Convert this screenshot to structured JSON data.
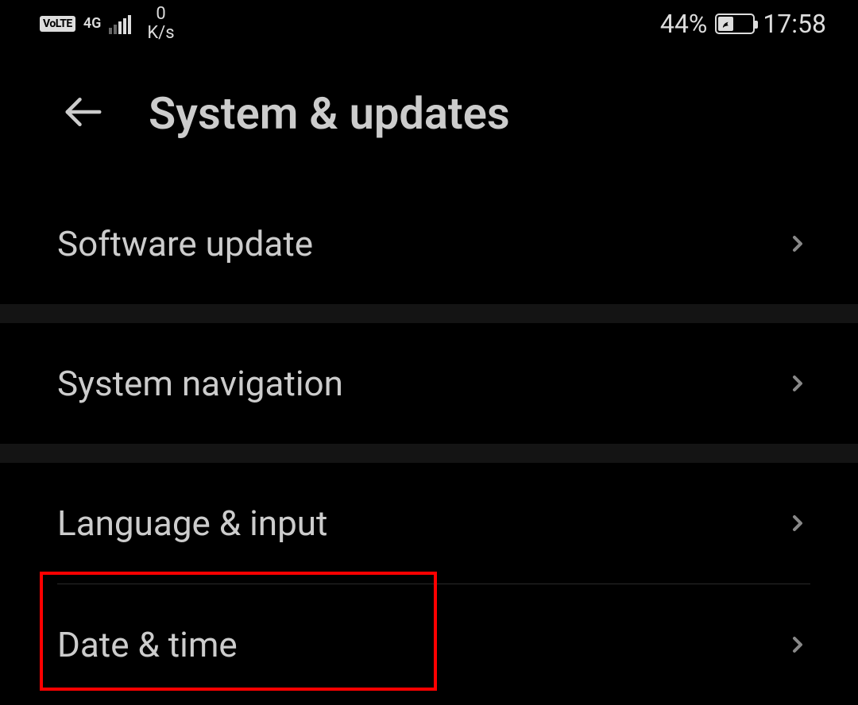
{
  "statusBar": {
    "volte": "VoLTE",
    "network": "4G",
    "dataSpeedValue": "0",
    "dataSpeedUnit": "K/s",
    "batteryPercent": "44%",
    "time": "17:58"
  },
  "header": {
    "title": "System & updates"
  },
  "settings": {
    "items": [
      {
        "label": "Software update"
      },
      {
        "label": "System navigation"
      },
      {
        "label": "Language & input"
      },
      {
        "label": "Date & time"
      }
    ]
  },
  "highlight": {
    "target": "date-time"
  }
}
